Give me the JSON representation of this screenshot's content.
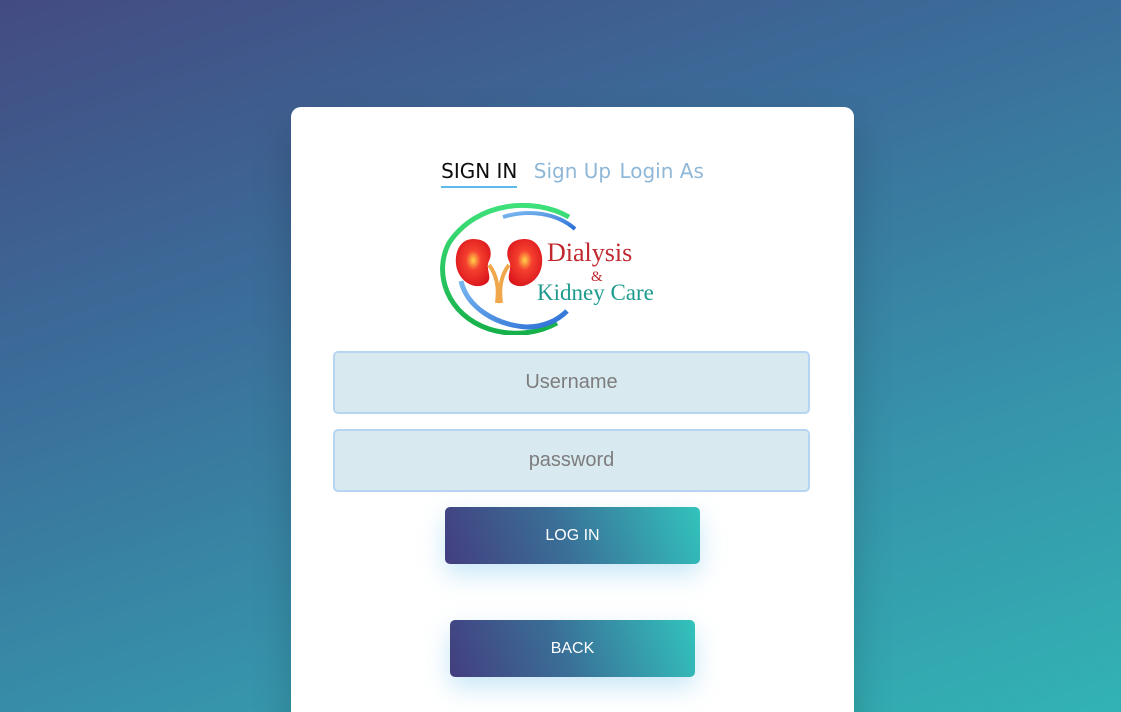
{
  "tabs": {
    "signin": "SIGN IN",
    "signup": "Sign Up",
    "loginas": "Login As"
  },
  "logo": {
    "line1": "Dialysis",
    "ampersand": "&",
    "line2": "Kidney Care"
  },
  "form": {
    "username_placeholder": "Username",
    "password_placeholder": "password",
    "username_value": "",
    "password_value": ""
  },
  "buttons": {
    "login": "LOG IN",
    "back": "BACK"
  },
  "colors": {
    "active_underline": "#5fbae9",
    "inactive_tab": "#8fb7d8",
    "field_bg": "#d9e9f0",
    "button_start": "#433e7f",
    "button_end": "#32c3bc"
  }
}
